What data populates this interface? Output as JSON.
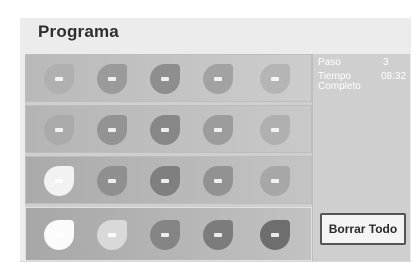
{
  "title": "Programa",
  "side": {
    "paso_label": "Paso",
    "paso_value": "3",
    "tiempo_label_1": "Tiempo",
    "tiempo_label_2": "Completo",
    "tiempo_value": "08:32",
    "clear_button": "Borrar Todo"
  },
  "icons": {
    "name": "turbine-segment-icon",
    "rows": [
      [
        "#b0b0b0",
        "#9a9a9a",
        "#8e8e8e",
        "#a2a2a2",
        "#b5b5b5"
      ],
      [
        "#aaaaaa",
        "#939393",
        "#878787",
        "#9c9c9c",
        "#b0b0b0"
      ],
      [
        "#f2f2f2",
        "#8f8f8f",
        "#7f7f7f",
        "#929292",
        "#a7a7a7"
      ],
      [
        "#fbfbfb",
        "#d9d9d9",
        "#858585",
        "#7c7c7c",
        "#6e6e6e"
      ]
    ]
  }
}
